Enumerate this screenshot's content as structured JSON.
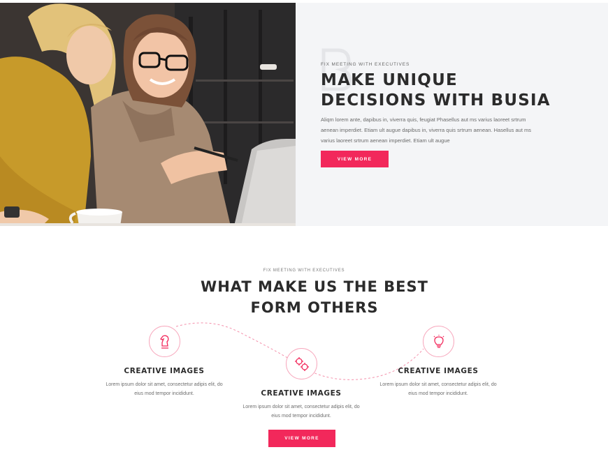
{
  "hero": {
    "image_alt": "two women looking at laptop",
    "kicker": "FIX MEETING WITH EXECUTIVES",
    "title_line1": "MAKE UNIQUE",
    "title_line2": "DECISIONS WITH BUSIA",
    "body": "Aliqm lorem ante, dapibus in, viverra quis, feugiat Phasellus aut ms varius laoreet srtrum aenean imperdiet. Etiam ult augue dapibus in, viverra quis srtrum aenean. Hasellus aut ms varius laoreet srtrum aenean imperdiet. Etiam ult augue",
    "button": "VIEW MORE"
  },
  "features": {
    "kicker": "FIX MEETING WITH EXECUTIVES",
    "title_line1": "WHAT MAKE US THE BEST",
    "title_line2": "FORM OTHERS",
    "items": [
      {
        "icon": "chess-knight-icon",
        "title": "CREATIVE IMAGES",
        "text": "Lorem ipsum dolor sit amet, consectetur adipis elit, do eius mod tempor incididunt."
      },
      {
        "icon": "gears-icon",
        "title": "CREATIVE IMAGES",
        "text": "Lorem ipsum dolor sit amet, consectetur adipis elit, do eius mod tempor incididunt."
      },
      {
        "icon": "lightbulb-icon",
        "title": "CREATIVE IMAGES",
        "text": "Lorem ipsum dolor sit amet, consectetur adipis elit, do eius mod tempor incididunt."
      }
    ],
    "button": "VIEW MORE"
  },
  "colors": {
    "accent": "#f2285b",
    "panel_bg": "#f4f5f7",
    "heading": "#2b2b2b"
  }
}
